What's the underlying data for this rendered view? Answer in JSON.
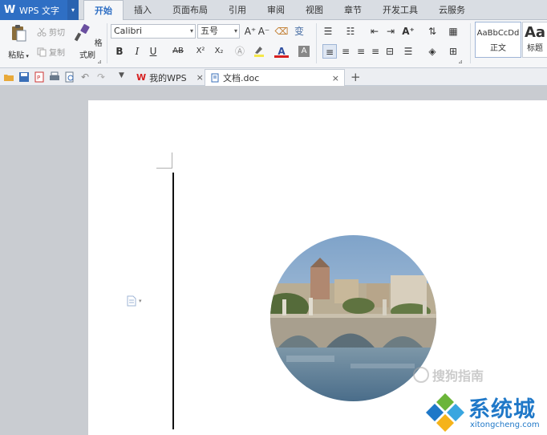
{
  "app": {
    "name": "WPS 文字",
    "logo_glyph": "W",
    "menu_arrow": "▾"
  },
  "tabs": [
    {
      "label": "开始",
      "active": true
    },
    {
      "label": "插入"
    },
    {
      "label": "页面布局"
    },
    {
      "label": "引用"
    },
    {
      "label": "审阅"
    },
    {
      "label": "视图"
    },
    {
      "label": "章节"
    },
    {
      "label": "开发工具"
    },
    {
      "label": "云服务"
    }
  ],
  "ribbon": {
    "clipboard": {
      "paste_label": "粘贴",
      "cut_label": "剪切",
      "copy_label": "复制",
      "format_painter_label": "格式刷"
    },
    "font": {
      "font_name": "Calibri",
      "font_size": "五号",
      "bold": "B",
      "italic": "I",
      "underline": "U",
      "strike": "AB",
      "superscript": "X²",
      "subscript": "X₂",
      "font_color_glyph": "A",
      "grow_glyph": "A⁺",
      "shrink_glyph": "A⁻"
    },
    "styles": {
      "normal_sample": "AaBbCcDd",
      "normal_label": "正文",
      "heading_sample": "Aa",
      "heading_label": "标题"
    }
  },
  "doc_tabs": [
    {
      "label": "我的WPS",
      "close": "×"
    },
    {
      "label": "文档.doc",
      "close": "×",
      "active": true
    }
  ],
  "new_tab_glyph": "+",
  "watermarks": {
    "sogou": "搜狗指南",
    "site_title": "系统城",
    "site_url": "xitongcheng.com"
  },
  "colors": {
    "accent": "#2f6fc4",
    "ribbon_bg": "#f5f6f8",
    "workspace_bg": "#c9ccd1",
    "font_color_underline": "#d62020",
    "site_blue": "#1f78c8"
  }
}
